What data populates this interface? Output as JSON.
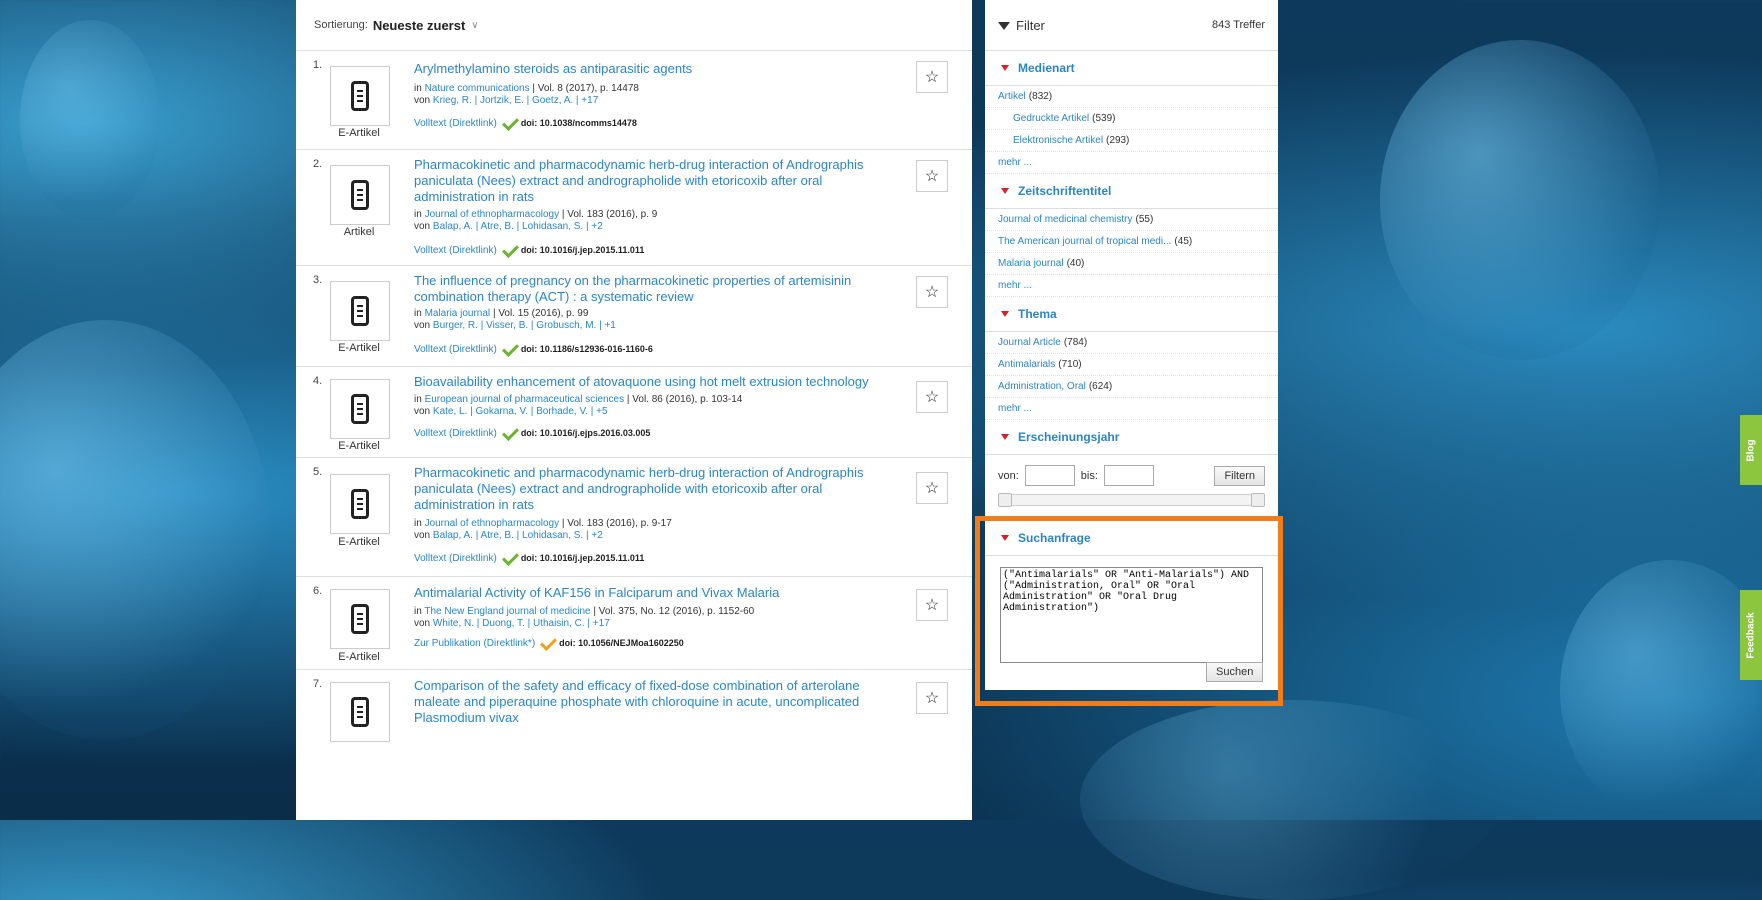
{
  "sort": {
    "label": "Sortierung:",
    "value": "Neueste zuerst"
  },
  "results": [
    {
      "num": "1.",
      "media": "E-Artikel",
      "title": "Arylmethylamino steroids as antiparasitic agents",
      "journal": "Nature communications",
      "details": "| Vol. 8 (2017), p. 14478",
      "authors_prefix": "von",
      "authors": "Krieg, R. | Jortzik, E. | Goetz, A. | +17",
      "fulltext": "Volltext (Direktlink)",
      "doi": "doi: 10.1038/ncomms14478"
    },
    {
      "num": "2.",
      "media": "Artikel",
      "title": "Pharmacokinetic and pharmacodynamic herb-drug interaction of Andrographis paniculata (Nees) extract and andrographolide with etoricoxib after oral administration in rats",
      "journal": "Journal of ethnopharmacology",
      "details": "| Vol. 183 (2016), p. 9",
      "authors_prefix": "von",
      "authors": "Balap, A. | Atre, B. | Lohidasan, S. | +2",
      "fulltext": "Volltext (Direktlink)",
      "doi": "doi: 10.1016/j.jep.2015.11.011"
    },
    {
      "num": "3.",
      "media": "E-Artikel",
      "title": "The influence of pregnancy on the pharmacokinetic properties of artemisinin combination therapy (ACT) : a systematic review",
      "journal": "Malaria journal",
      "details": "| Vol. 15 (2016), p. 99",
      "authors_prefix": "von",
      "authors": "Burger, R. | Visser, B. | Grobusch, M. | +1",
      "fulltext": "Volltext (Direktlink)",
      "doi": "doi: 10.1186/s12936-016-1160-6"
    },
    {
      "num": "4.",
      "media": "E-Artikel",
      "title": "Bioavailability enhancement of atovaquone using hot melt extrusion technology",
      "journal": "European journal of pharmaceutical sciences",
      "details": "| Vol. 86 (2016), p. 103-14",
      "authors_prefix": "von",
      "authors": "Kate, L. | Gokarna, V. | Borhade, V. | +5",
      "fulltext": "Volltext (Direktlink)",
      "doi": "doi: 10.1016/j.ejps.2016.03.005"
    },
    {
      "num": "5.",
      "media": "E-Artikel",
      "title": "Pharmacokinetic and pharmacodynamic herb-drug interaction of Andrographis paniculata (Nees) extract and andrographolide with etoricoxib after oral administration in rats",
      "journal": "Journal of ethnopharmacology",
      "details": "| Vol. 183 (2016), p. 9-17",
      "authors_prefix": "von",
      "authors": "Balap, A. | Atre, B. | Lohidasan, S. | +2",
      "fulltext": "Volltext (Direktlink)",
      "doi": "doi: 10.1016/j.jep.2015.11.011"
    },
    {
      "num": "6.",
      "media": "E-Artikel",
      "title": "Antimalarial Activity of KAF156 in Falciparum and Vivax Malaria",
      "journal": "The New England journal of medicine",
      "details": "| Vol. 375, No. 12 (2016), p. 1152-60",
      "authors_prefix": "von",
      "authors": "White, N. | Duong, T. | Uthaisin, C. | +17",
      "fulltext": "Zur Publikation (Direktlink*)",
      "doi": "doi: 10.1056/NEJMoa1602250"
    },
    {
      "num": "7.",
      "media": "",
      "title": "Comparison of the safety and efficacy of fixed-dose combination of arterolane maleate and piperaquine phosphate with chloroquine in acute, uncomplicated Plasmodium vivax",
      "journal": "",
      "details": "",
      "authors_prefix": "",
      "authors": "",
      "fulltext": "",
      "doi": ""
    }
  ],
  "filter": {
    "title": "Filter",
    "count": "843 Treffer",
    "medienart": {
      "title": "Medienart",
      "items": [
        {
          "label": "Artikel",
          "count": "(832)"
        },
        {
          "label": "Gedruckte Artikel",
          "count": "(539)"
        },
        {
          "label": "Elektronische Artikel",
          "count": "(293)"
        }
      ],
      "more": "mehr ..."
    },
    "zeitschrift": {
      "title": "Zeitschriftentitel",
      "items": [
        {
          "label": "Journal of medicinal chemistry",
          "count": "(55)"
        },
        {
          "label": "The American journal of tropical medi...",
          "count": "(45)"
        },
        {
          "label": "Malaria journal",
          "count": "(40)"
        }
      ],
      "more": "mehr ..."
    },
    "thema": {
      "title": "Thema",
      "items": [
        {
          "label": "Journal Article",
          "count": "(784)"
        },
        {
          "label": "Antimalarials",
          "count": "(710)"
        },
        {
          "label": "Administration, Oral",
          "count": "(624)"
        }
      ],
      "more": "mehr ..."
    },
    "jahr": {
      "title": "Erscheinungsjahr",
      "from": "von:",
      "to": "bis:",
      "button": "Filtern"
    },
    "query": {
      "title": "Suchanfrage",
      "text": "(\"Antimalarials\" OR \"Anti-Malarials\") AND (\"Administration, Oral\" OR \"Oral Administration\" OR \"Oral Drug Administration\")",
      "button": "Suchen"
    }
  },
  "tabs": {
    "blog": "Blog",
    "feedback": "Feedback"
  }
}
